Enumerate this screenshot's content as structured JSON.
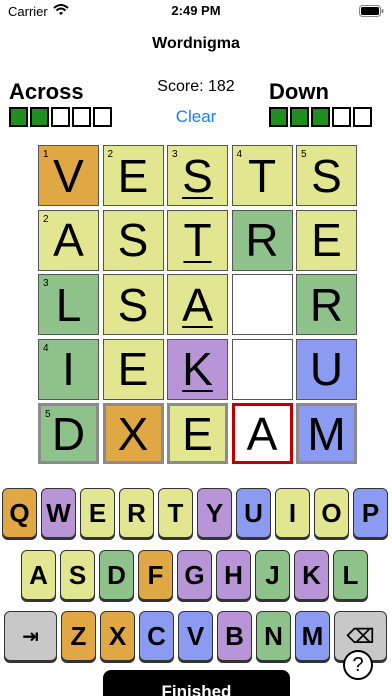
{
  "status": {
    "carrier": "Carrier",
    "time": "2:49 PM"
  },
  "app": {
    "title": "Wordnigma"
  },
  "header": {
    "across_label": "Across",
    "down_label": "Down",
    "score": "Score: 182",
    "clear_label": "Clear",
    "across_progress": [
      true,
      true,
      false,
      false,
      false
    ],
    "down_progress": [
      true,
      true,
      true,
      false,
      false
    ]
  },
  "colors": {
    "yellow": "#e3e691",
    "green": "#8fc28a",
    "orange": "#e0a844",
    "purple": "#b795d6",
    "blue": "#8c9bf2",
    "gray": "#c8c8c8",
    "white": "#ffffff",
    "progress_on": "#1f8f1f",
    "link": "#1a7ff0",
    "current_border": "#c00000"
  },
  "board": [
    [
      {
        "l": "V",
        "n": "1",
        "c": "orange"
      },
      {
        "l": "E",
        "n": "2",
        "c": "yellow"
      },
      {
        "l": "S",
        "n": "3",
        "c": "yellow",
        "u": true
      },
      {
        "l": "T",
        "n": "4",
        "c": "yellow"
      },
      {
        "l": "S",
        "n": "5",
        "c": "yellow"
      }
    ],
    [
      {
        "l": "A",
        "n": "2",
        "c": "yellow"
      },
      {
        "l": "S",
        "c": "yellow"
      },
      {
        "l": "T",
        "c": "yellow",
        "u": true
      },
      {
        "l": "R",
        "c": "green"
      },
      {
        "l": "E",
        "c": "yellow"
      }
    ],
    [
      {
        "l": "L",
        "n": "3",
        "c": "green"
      },
      {
        "l": "S",
        "c": "yellow"
      },
      {
        "l": "A",
        "c": "yellow",
        "u": true
      },
      {
        "l": "",
        "c": "white"
      },
      {
        "l": "R",
        "c": "green"
      }
    ],
    [
      {
        "l": "I",
        "n": "4",
        "c": "green"
      },
      {
        "l": "E",
        "c": "yellow"
      },
      {
        "l": "K",
        "c": "purple",
        "u": true
      },
      {
        "l": "",
        "c": "white"
      },
      {
        "l": "U",
        "c": "blue"
      }
    ],
    [
      {
        "l": "D",
        "n": "5",
        "c": "green",
        "s": "sel"
      },
      {
        "l": "X",
        "c": "orange",
        "s": "sel"
      },
      {
        "l": "E",
        "c": "yellow",
        "s": "sel"
      },
      {
        "l": "A",
        "c": "white",
        "s": "cur"
      },
      {
        "l": "M",
        "c": "blue",
        "s": "sel"
      }
    ]
  ],
  "keyboard": {
    "rows": [
      [
        {
          "k": "Q",
          "c": "orange"
        },
        {
          "k": "W",
          "c": "purple"
        },
        {
          "k": "E",
          "c": "yellow"
        },
        {
          "k": "R",
          "c": "yellow"
        },
        {
          "k": "T",
          "c": "yellow"
        },
        {
          "k": "Y",
          "c": "purple"
        },
        {
          "k": "U",
          "c": "blue"
        },
        {
          "k": "I",
          "c": "yellow"
        },
        {
          "k": "O",
          "c": "yellow"
        },
        {
          "k": "P",
          "c": "blue"
        }
      ],
      [
        {
          "k": "A",
          "c": "yellow"
        },
        {
          "k": "S",
          "c": "yellow"
        },
        {
          "k": "D",
          "c": "green"
        },
        {
          "k": "F",
          "c": "orange"
        },
        {
          "k": "G",
          "c": "purple"
        },
        {
          "k": "H",
          "c": "purple"
        },
        {
          "k": "J",
          "c": "green"
        },
        {
          "k": "K",
          "c": "purple"
        },
        {
          "k": "L",
          "c": "green"
        }
      ],
      [
        {
          "k": "⇥",
          "c": "gray",
          "wide": true
        },
        {
          "k": "Z",
          "c": "orange"
        },
        {
          "k": "X",
          "c": "orange"
        },
        {
          "k": "C",
          "c": "blue"
        },
        {
          "k": "V",
          "c": "blue"
        },
        {
          "k": "B",
          "c": "purple"
        },
        {
          "k": "N",
          "c": "green"
        },
        {
          "k": "M",
          "c": "blue"
        },
        {
          "k": "⌫",
          "c": "gray",
          "wide": true
        }
      ]
    ]
  },
  "footer": {
    "help": "?",
    "finished": "Finished"
  }
}
